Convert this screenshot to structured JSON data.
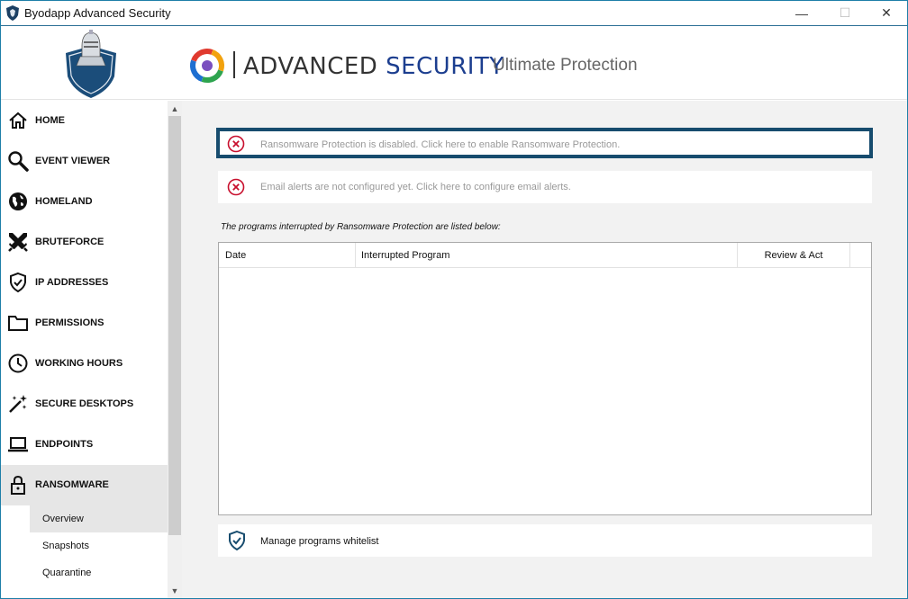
{
  "window": {
    "title": "Byodapp Advanced Security",
    "minimize": "—",
    "maximize": "☐",
    "close": "✕"
  },
  "header": {
    "brand_part1": "ADVANCED ",
    "brand_part2": "SECURITY",
    "subtitle": "Ultimate Protection"
  },
  "sidebar": {
    "items": [
      {
        "label": "HOME",
        "icon": "home-icon"
      },
      {
        "label": "EVENT VIEWER",
        "icon": "magnifier-icon"
      },
      {
        "label": "HOMELAND",
        "icon": "globe-icon"
      },
      {
        "label": "BRUTEFORCE",
        "icon": "crossed-swords-icon"
      },
      {
        "label": "IP ADDRESSES",
        "icon": "shield-check-icon"
      },
      {
        "label": "PERMISSIONS",
        "icon": "folder-icon"
      },
      {
        "label": "WORKING HOURS",
        "icon": "clock-icon"
      },
      {
        "label": "SECURE DESKTOPS",
        "icon": "magic-wand-icon"
      },
      {
        "label": "ENDPOINTS",
        "icon": "laptop-icon"
      },
      {
        "label": "RANSOMWARE",
        "icon": "lock-icon",
        "active": true
      }
    ],
    "sub_items": [
      {
        "label": "Overview",
        "active": true
      },
      {
        "label": "Snapshots"
      },
      {
        "label": "Quarantine"
      }
    ]
  },
  "main": {
    "alerts": [
      {
        "text": "Ransomware Protection is disabled. Click here to enable Ransomware Protection.",
        "icon": "error-x-icon"
      },
      {
        "text": "Email alerts are not configured yet. Click here to configure email alerts.",
        "icon": "error-x-icon"
      }
    ],
    "list_caption": "The programs interrupted by Ransomware Protection are listed below:",
    "table": {
      "columns": [
        "Date",
        "Interrupted Program",
        "Review & Act"
      ],
      "rows": []
    },
    "whitelist_label": "Manage programs whitelist"
  },
  "colors": {
    "accent": "#174c6e",
    "error": "#c8102e",
    "brand_blue": "#1c3e8f"
  }
}
